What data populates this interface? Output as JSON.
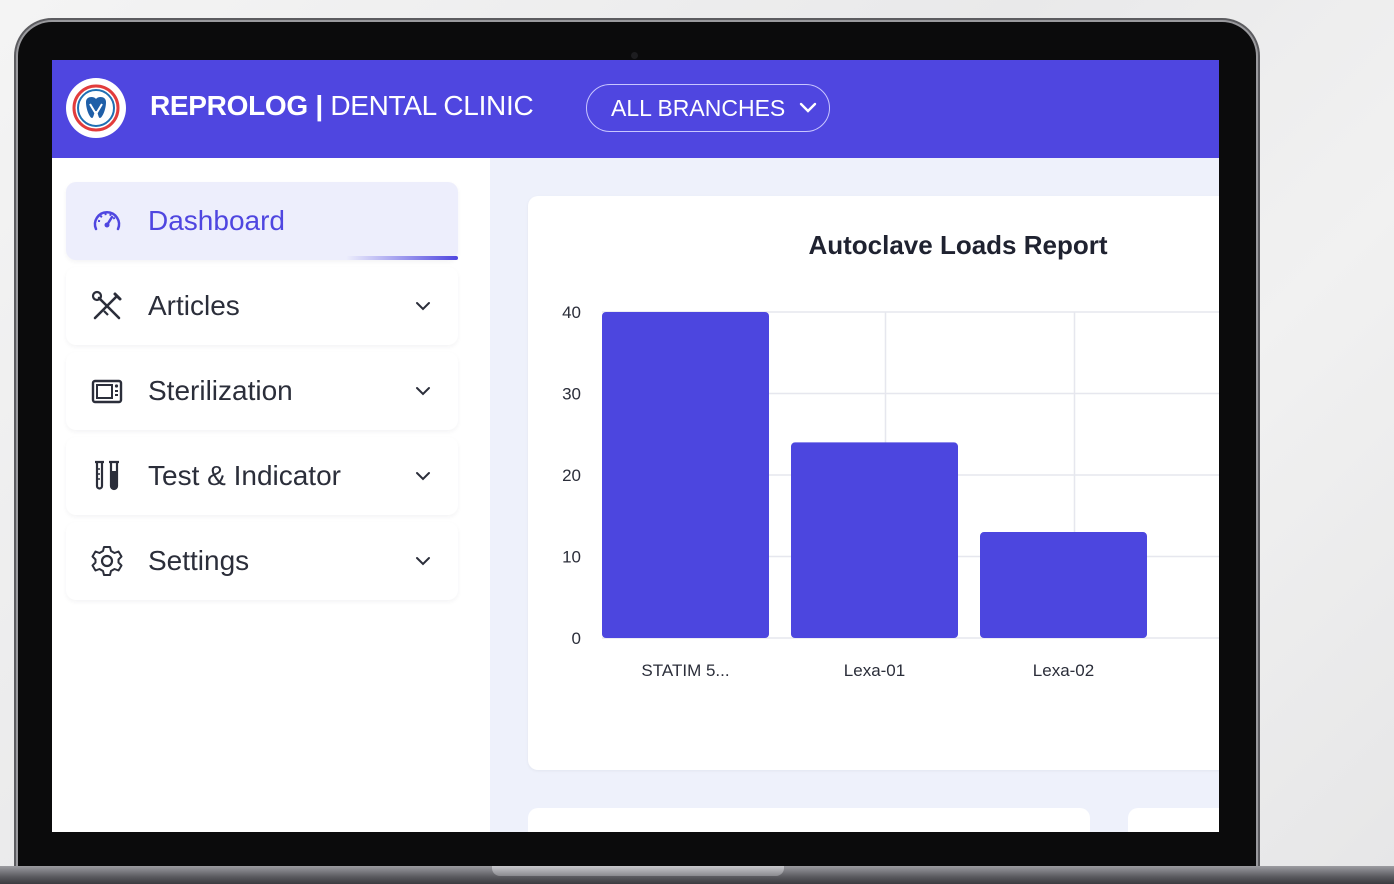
{
  "header": {
    "brand_bold": "REPROLOG |",
    "brand_light": "DENTAL CLINIC",
    "branch_label": "ALL BRANCHES"
  },
  "sidebar": {
    "items": [
      {
        "label": "Dashboard",
        "icon": "dashboard-gauge-icon",
        "active": true
      },
      {
        "label": "Articles",
        "icon": "crossed-tools-icon"
      },
      {
        "label": "Sterilization",
        "icon": "autoclave-icon"
      },
      {
        "label": "Test & Indicator",
        "icon": "test-tubes-icon"
      },
      {
        "label": "Settings",
        "icon": "gear-icon"
      }
    ]
  },
  "colors": {
    "accent": "#4f46e0",
    "bar": "#4c46df"
  },
  "chart_data": {
    "type": "bar",
    "title": "Autoclave Loads Report",
    "categories": [
      "STATIM 5...",
      "Lexa-01",
      "Lexa-02"
    ],
    "values": [
      40,
      24,
      13
    ],
    "ylim": [
      0,
      40
    ],
    "yticks": [
      "0",
      "10",
      "20",
      "30",
      "40"
    ],
    "grid": true,
    "xlabel": "",
    "ylabel": ""
  }
}
